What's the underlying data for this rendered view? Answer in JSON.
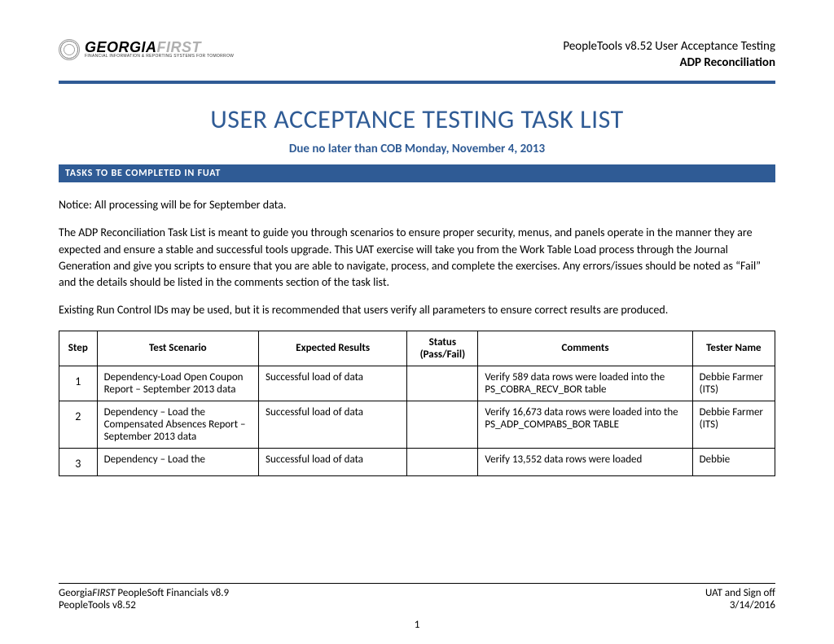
{
  "header": {
    "logo_main1": "GEORGIA",
    "logo_main2": "FIRST",
    "logo_sub": "FINANCIAL INFORMATION & REPORTING SYSTEMS FOR TOMORROW",
    "right_line1": "PeopleTools v8.52 User Acceptance Testing",
    "right_line2": "ADP Reconciliation"
  },
  "title": "USER ACCEPTANCE TESTING TASK LIST",
  "subtitle": "Due no later than COB Monday, November 4, 2013",
  "section_bar": "TASKS TO BE COMPLETED IN FUAT",
  "para1": "Notice:  All processing will be for September data.",
  "para2": "The ADP Reconciliation Task List is meant to guide you through scenarios to ensure proper security, menus, and panels operate in the manner they are expected and ensure a stable and successful tools upgrade.  This UAT exercise will take you from the Work Table Load process through the Journal Generation and give you scripts to ensure that you are able to navigate, process, and complete the exercises.  Any errors/issues should be noted as “Fail” and the details should be listed in the comments section of the task list.",
  "para3": "Existing Run Control IDs may be used, but it is recommended that users verify all parameters to ensure correct results are produced.",
  "columns": {
    "step": "Step",
    "scenario": "Test Scenario",
    "expected": "Expected Results",
    "status": "Status (Pass/Fail)",
    "comments": "Comments",
    "tester": "Tester Name"
  },
  "rows": [
    {
      "step": "1",
      "scenario": "Dependency-Load Open Coupon Report – September 2013 data",
      "expected": "Successful load of data",
      "status": "",
      "comments": "Verify 589 data rows were loaded into the PS_COBRA_RECV_BOR table",
      "tester": "Debbie Farmer (ITS)"
    },
    {
      "step": "2",
      "scenario": "Dependency – Load the Compensated Absences Report – September 2013 data",
      "expected": "Successful load of data",
      "status": "",
      "comments": "Verify 16,673 data rows were loaded into the PS_ADP_COMPABS_BOR TABLE",
      "tester": "Debbie Farmer (ITS)"
    },
    {
      "step": "3",
      "scenario": "Dependency – Load the",
      "expected": "Successful load of data",
      "status": "",
      "comments": "Verify 13,552 data rows were loaded",
      "tester": "Debbie"
    }
  ],
  "footer": {
    "left_line1a": "Georgia",
    "left_line1b": "FIRST",
    "left_line1c": " PeopleSoft Financials v8.9",
    "left_line2": "PeopleTools v8.52",
    "right_line1": "UAT and Sign off",
    "right_line2": "3/14/2016"
  },
  "page_number": "1"
}
